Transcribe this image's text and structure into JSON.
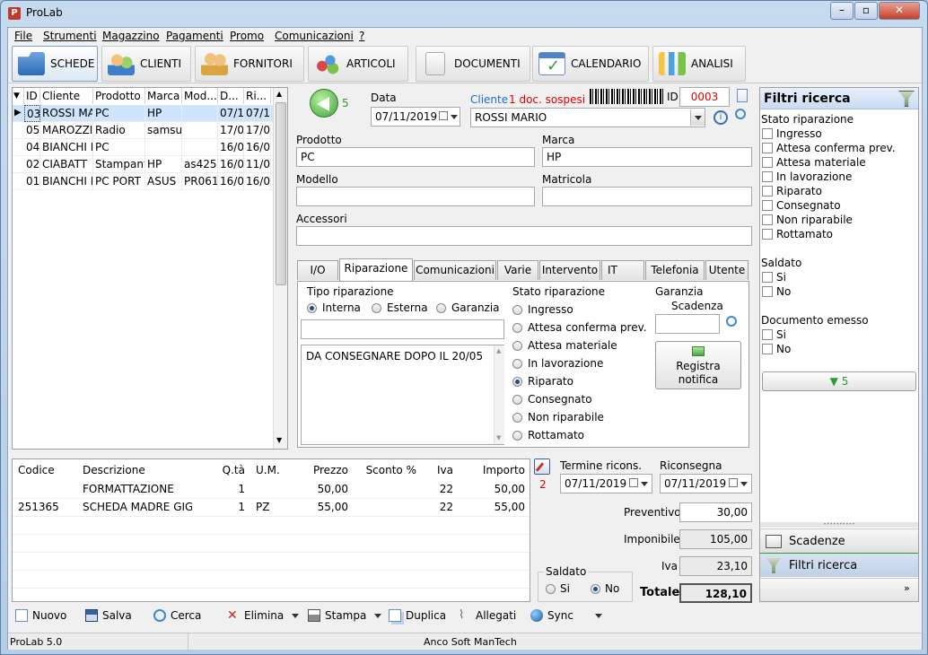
{
  "app": {
    "title": "ProLab",
    "logo": "P"
  },
  "menu": [
    "File",
    "Strumenti",
    "Magazzino",
    "Pagamenti",
    "Promo",
    "Comunicazioni",
    "?"
  ],
  "toolbar": [
    {
      "label": "SCHEDE",
      "icon": "folder-icon",
      "active": true
    },
    {
      "label": "CLIENTI",
      "icon": "users-icon",
      "active": false
    },
    {
      "label": "FORNITORI",
      "icon": "suppliers-icon",
      "active": false
    },
    {
      "label": "ARTICOLI",
      "icon": "items-icon",
      "active": false
    },
    {
      "label": "DOCUMENTI",
      "icon": "documents-icon",
      "active": false
    },
    {
      "label": "CALENDARIO",
      "icon": "calendar-icon",
      "active": false
    },
    {
      "label": "ANALISI",
      "icon": "chart-icon",
      "active": false
    }
  ],
  "list": {
    "columns": [
      "ID",
      "Cliente",
      "Prodotto",
      "Marca",
      "Mod...",
      "D...",
      "Ri..."
    ],
    "rows": [
      [
        "03",
        "ROSSI MA",
        "PC",
        "HP",
        "",
        "07/1",
        "07/1"
      ],
      [
        "05",
        "MAROZZI",
        "Radio",
        "samsu",
        "",
        "17/0",
        "17/0"
      ],
      [
        "04",
        "BIANCHI F",
        "PC",
        "",
        "",
        "16/0",
        "16/0"
      ],
      [
        "02",
        "CIABATT",
        "Stampant",
        "HP",
        "as425",
        "16/0",
        "11/0"
      ],
      [
        "01",
        "BIANCHI F",
        "PC PORT",
        "ASUS",
        "PR061",
        "16/0",
        "16/0"
      ]
    ]
  },
  "form": {
    "nav_count": "5",
    "data_label": "Data",
    "data_value": "07/11/2019",
    "cliente_label": "Cliente",
    "sospesi": "1 doc. sospesi",
    "cliente_value": "ROSSI MARIO",
    "id_label": "ID",
    "id_value": "0003",
    "prodotto_label": "Prodotto",
    "prodotto_value": "PC",
    "marca_label": "Marca",
    "marca_value": "HP",
    "modello_label": "Modello",
    "modello_value": "",
    "matricola_label": "Matricola",
    "matricola_value": "",
    "accessori_label": "Accessori",
    "accessori_value": ""
  },
  "tabs": [
    "I/O",
    "Riparazione",
    "Comunicazioni",
    "Varie",
    "Intervento",
    "IT",
    "Telefonia",
    "Utente"
  ],
  "riparazione": {
    "tipo_label": "Tipo riparazione",
    "tipo_options": [
      "Interna",
      "Esterna",
      "Garanzia"
    ],
    "tipo_selected": "Interna",
    "note": "DA CONSEGNARE DOPO IL 20/05",
    "stato_label": "Stato riparazione",
    "stato_options": [
      "Ingresso",
      "Attesa conferma prev.",
      "Attesa materiale",
      "In lavorazione",
      "Riparato",
      "Consegnato",
      "Non riparabile",
      "Rottamato"
    ],
    "stato_selected": "Riparato",
    "garanzia_label": "Garanzia",
    "scadenza_label": "Scadenza",
    "registra_label": "Registra notifica"
  },
  "items": {
    "columns": [
      "Codice",
      "Descrizione",
      "Q.tà",
      "U.M.",
      "Prezzo",
      "Sconto %",
      "Iva",
      "Importo"
    ],
    "rows": [
      [
        "",
        "FORMATTAZIONE",
        "1",
        "",
        "50,00",
        "",
        "22",
        "50,00"
      ],
      [
        "251365",
        "SCHEDA MADRE GIG...",
        "1",
        "PZ",
        "55,00",
        "",
        "22",
        "55,00"
      ]
    ]
  },
  "totals": {
    "count": "2",
    "termine_label": "Termine ricons.",
    "termine_value": "07/11/2019",
    "riconsegna_label": "Riconsegna",
    "riconsegna_value": "07/11/2019",
    "preventivo_label": "Preventivo",
    "preventivo_value": "30,00",
    "imponibile_label": "Imponibile",
    "imponibile_value": "105,00",
    "iva_label": "Iva",
    "iva_value": "23,10",
    "totale_label": "Totale",
    "totale_value": "128,10",
    "saldato_label": "Saldato",
    "si_label": "Si",
    "no_label": "No"
  },
  "filters": {
    "title": "Filtri ricerca",
    "stato_label": "Stato riparazione",
    "stato_options": [
      "Ingresso",
      "Attesa conferma prev.",
      "Attesa materiale",
      "In lavorazione",
      "Riparato",
      "Consegnato",
      "Non riparabile",
      "Rottamato"
    ],
    "saldato_label": "Saldato",
    "saldato_options": [
      "Si",
      "No"
    ],
    "documento_label": "Documento emesso",
    "documento_options": [
      "Si",
      "No"
    ],
    "apply_count": "5",
    "nav_scadenze": "Scadenze",
    "nav_filtri": "Filtri ricerca"
  },
  "bottom_actions": [
    "Nuovo",
    "Salva",
    "Cerca",
    "Elimina",
    "Stampa",
    "Duplica",
    "Allegati",
    "Sync"
  ],
  "status": {
    "left": "ProLab 5.0",
    "center": "Anco Soft ManTech"
  },
  "colors": {
    "accent": "#1c6ec8",
    "red": "#e00000",
    "green": "#2a9d2a",
    "selected_row": "#cde4fb"
  }
}
